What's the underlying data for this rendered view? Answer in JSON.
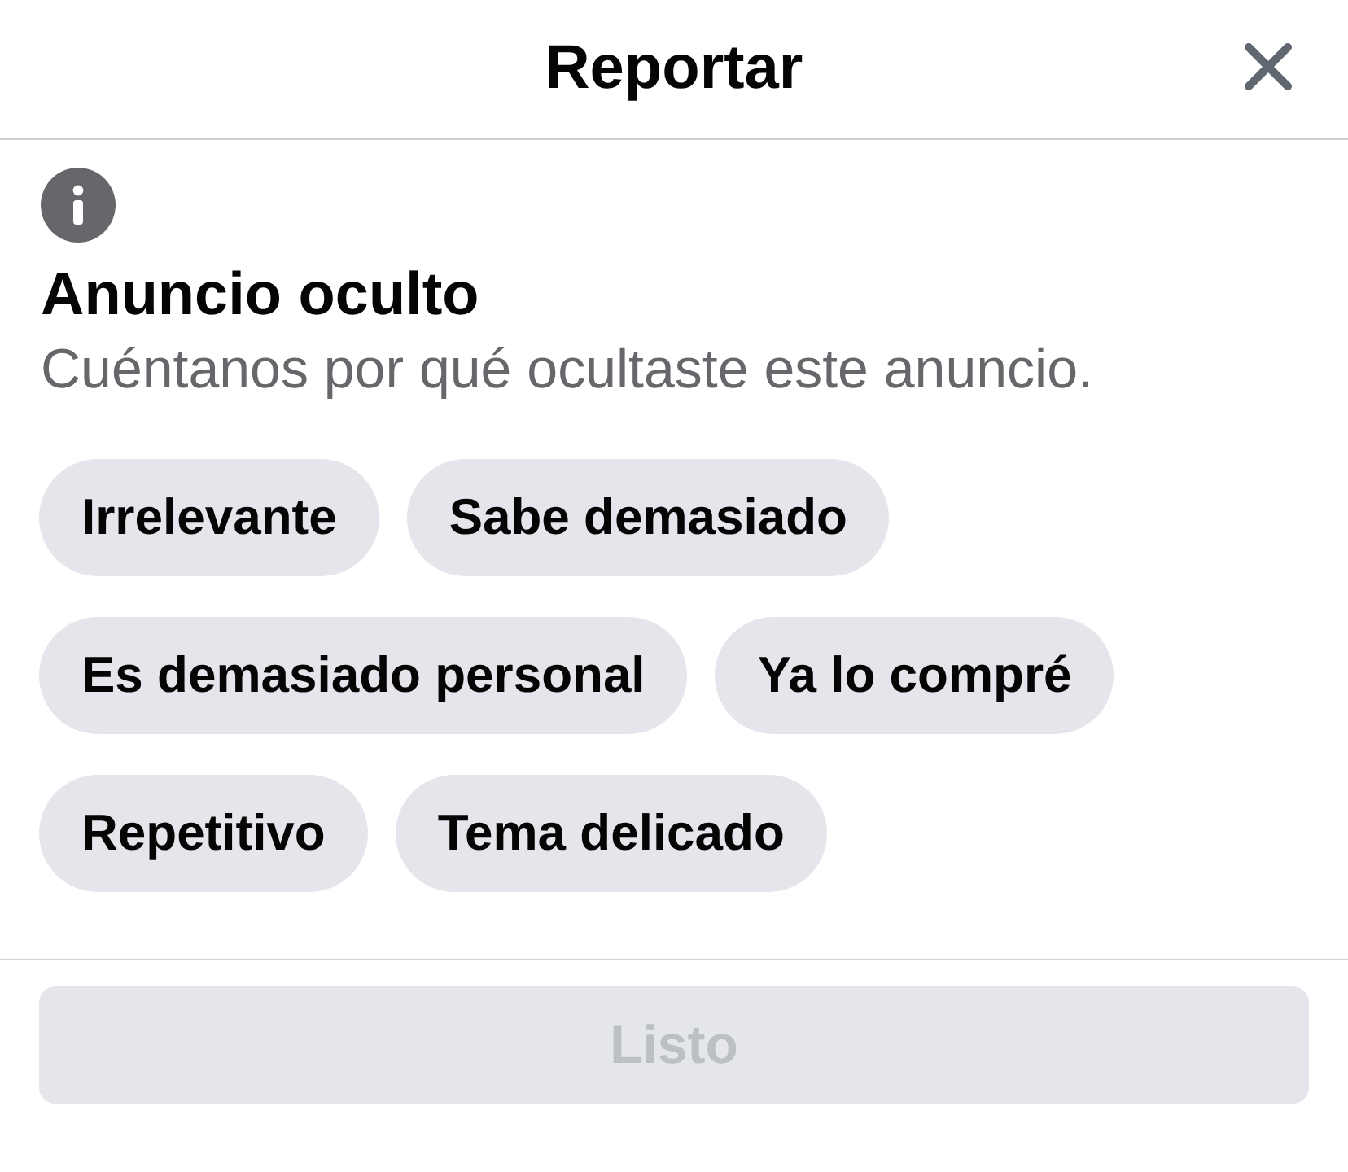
{
  "header": {
    "title": "Reportar"
  },
  "notice": {
    "heading": "Anuncio oculto",
    "description": "Cuéntanos por qué ocultaste este anuncio."
  },
  "reasons": [
    {
      "label": "Irrelevante",
      "selected": false
    },
    {
      "label": "Sabe demasiado",
      "selected": false
    },
    {
      "label": "Es demasiado personal",
      "selected": false
    },
    {
      "label": "Ya lo compré",
      "selected": false
    },
    {
      "label": "Repetitivo",
      "selected": false
    },
    {
      "label": "Tema delicado",
      "selected": false
    }
  ],
  "footer": {
    "button": {
      "label": "Listo",
      "disabled": true
    }
  }
}
